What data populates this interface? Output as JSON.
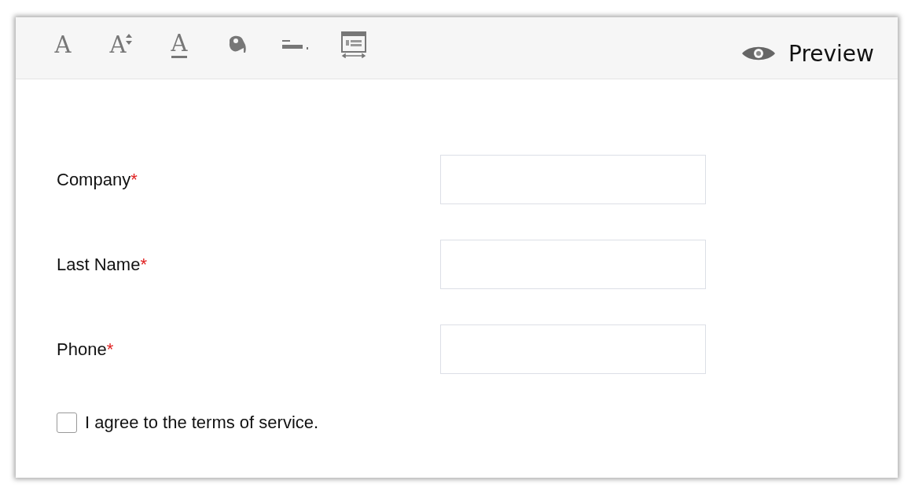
{
  "toolbar": {
    "tools": [
      {
        "kind": "font",
        "glyph": "A"
      },
      {
        "kind": "font_size",
        "glyph": "A"
      },
      {
        "kind": "font_color",
        "glyph": "A"
      },
      {
        "kind": "fill"
      },
      {
        "kind": "border"
      },
      {
        "kind": "layout"
      }
    ],
    "preview": "Preview"
  },
  "fields": [
    {
      "label": "Company",
      "required_mark": "*"
    },
    {
      "label": "Last Name",
      "required_mark": "*"
    },
    {
      "label": "Phone",
      "required_mark": "*"
    }
  ],
  "agreement": {
    "label": "I agree to the terms of service.",
    "checked": false
  }
}
